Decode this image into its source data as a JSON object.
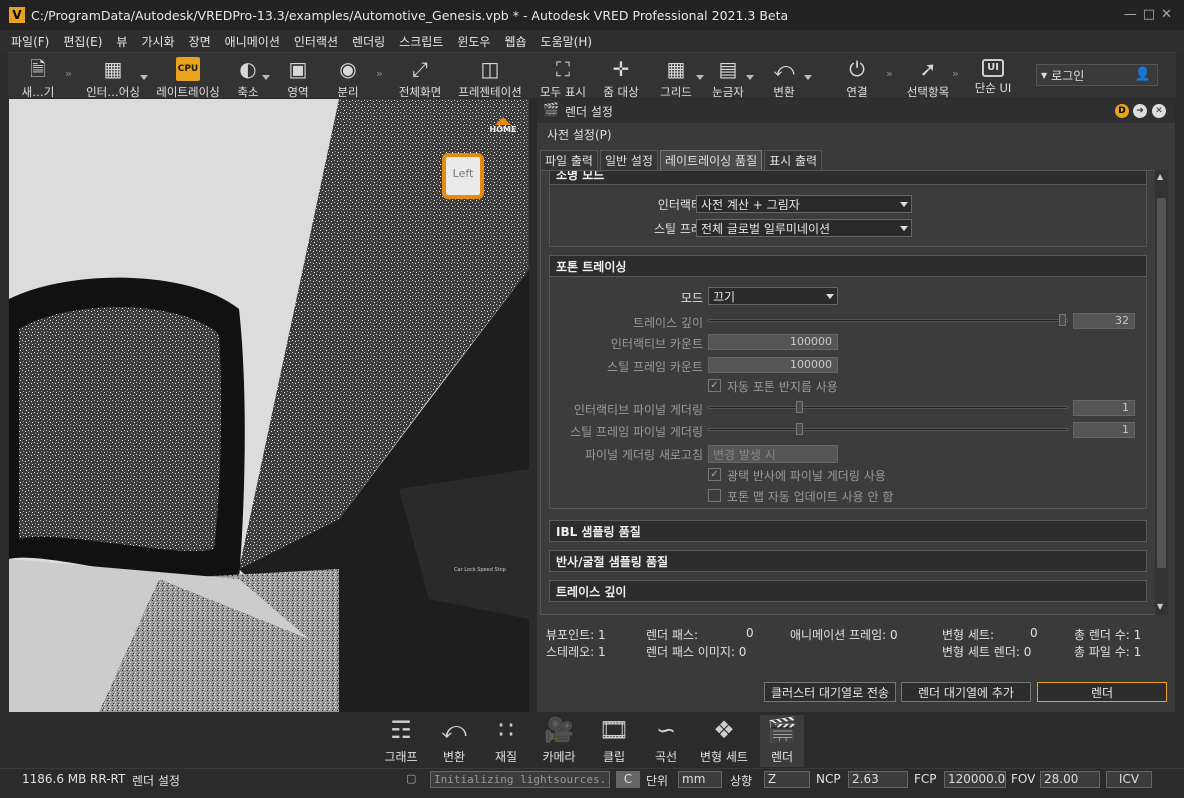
{
  "window": {
    "title": "C:/ProgramData/Autodesk/VREDPro-13.3/examples/Automotive_Genesis.vpb * - Autodesk VRED Professional 2021.3 Beta",
    "app_icon": "V"
  },
  "menu": [
    "파일(F)",
    "편집(E)",
    "뷰",
    "가시화",
    "장면",
    "애니메이션",
    "인터랙션",
    "렌더링",
    "스크립트",
    "윈도우",
    "웹숍",
    "도움말(H)"
  ],
  "toolbar": {
    "new": "새…기",
    "interactive": "인터…어싱",
    "raytracing": "레이트레이싱",
    "raytracing_badge": "CPU",
    "shrink": "축소",
    "region": "영역",
    "separate": "분리",
    "fullscreen": "전체화면",
    "presentation": "프레젠테이션",
    "show_all": "모두 표시",
    "zoom_target": "줌 대상",
    "grid": "그리드",
    "ruler": "눈금자",
    "transform": "변환",
    "connect": "연결",
    "selection": "선택항목",
    "simple_ui": "단순 UI",
    "simple_ui_badge": "UI"
  },
  "login": {
    "label": "로그인"
  },
  "viewport": {
    "cube_label": "Left",
    "home_label": "HOME",
    "screen_text": "Car Lock Speed Stop"
  },
  "panel": {
    "title": "렌더 설정",
    "presets": "사전 설정(P)",
    "tabs": [
      "파일 출력",
      "일반 설정",
      "레이트레이싱 품질",
      "표시 출력"
    ],
    "shadow_mode": {
      "header": "소명 모드",
      "interactive_label": "인터랙티브",
      "interactive_value": "사전 계산 + 그림자",
      "still_label": "스틸 프레임",
      "still_value": "전체 글로벌 일루미네이션"
    },
    "photon": {
      "header": "포톤 트레이싱",
      "mode_label": "모드",
      "mode_value": "끄기",
      "trace_depth_label": "트레이스 깊이",
      "trace_depth_value": "32",
      "interactive_count_label": "인터랙티브 카운트",
      "interactive_count_value": "100000",
      "still_count_label": "스틸 프레임 카운트",
      "still_count_value": "100000",
      "auto_radius_label": "자동 포톤 반지름 사용",
      "interactive_final_label": "인터랙티브 파이널 게더링",
      "interactive_final_value": "1",
      "still_final_label": "스틸 프레임 파이널 게더링",
      "still_final_value": "1",
      "refresh_label": "파이널 게더링 새로고침",
      "refresh_value": "변경 발생 시",
      "glossy_label": "광택 반사에 파이널 게더링 사용",
      "no_auto_update_label": "포톤 맵 자동 업데이트 사용 안 함"
    },
    "ibl_header": "IBL 샘플링 품질",
    "refl_header": "반사/굴절 샘플링 품질",
    "trace_header": "트레이스 깊이",
    "stats": {
      "viewport": "뷰포인트: 1",
      "stereo": "스테레오: 1",
      "render_pass_label": "렌더 패스:",
      "render_pass_value": "0",
      "render_pass_img": "렌더 패스 이미지: 0",
      "anim_frame": "애니메이션 프레임: 0",
      "variant_set_label": "변형 세트:",
      "variant_set_value": "0",
      "variant_render": "변형 세트 렌더: 0",
      "total_render": "총 렌더 수: 1",
      "total_file": "총 파일 수: 1"
    },
    "buttons": {
      "cluster": "클러스터 대기열로 전송",
      "queue": "렌더 대기열에 추가",
      "render": "렌더"
    }
  },
  "dock": [
    "그래프",
    "변환",
    "재질",
    "카메라",
    "클립",
    "곡선",
    "변형 세트",
    "렌더"
  ],
  "status": {
    "memory": "1186.6 MB",
    "mode": "RR-RT",
    "module": "렌더 설정",
    "message": "Initializing lightsources...",
    "c_label": "C",
    "unit_label": "단위",
    "unit_value": "mm",
    "up_label": "상향",
    "up_value": "Z",
    "ncp_label": "NCP",
    "ncp_value": "2.63",
    "fcp_label": "FCP",
    "fcp_value": "120000.00",
    "fov_label": "FOV",
    "fov_value": "28.00",
    "icv": "ICV"
  },
  "colors": {
    "accent": "#e8a21b",
    "background": "#2b2b2b",
    "panel": "#3a3a3a"
  }
}
